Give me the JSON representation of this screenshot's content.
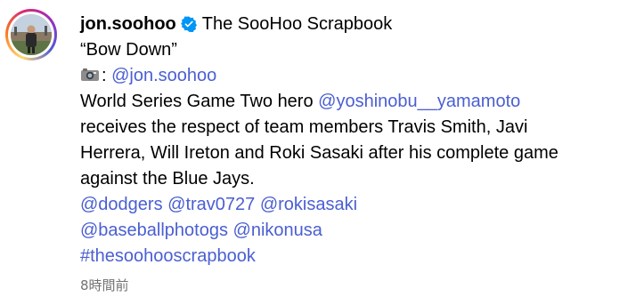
{
  "post": {
    "username": "jon.soohoo",
    "account_title": "The SooHoo Scrapbook",
    "verified": true,
    "quote_title": "“Bow Down”",
    "credit": {
      "icon": "camera-icon",
      "separator": ":",
      "handle": "@jon.soohoo"
    },
    "caption_lines": [
      {
        "text": "World Series Game Two hero ",
        "mention": "@yoshinobu__yamamoto"
      },
      {
        "text": "receives the respect of team members Travis Smith, Javi"
      },
      {
        "text": "Herrera, Will Ireton and Roki Sasaki after his complete game"
      },
      {
        "text": "against the Blue Jays."
      }
    ],
    "mentions_line_1": [
      "@dodgers",
      "@trav0727",
      "@rokisasaki"
    ],
    "mentions_line_2": [
      "@baseballphotogs",
      "@nikonusa"
    ],
    "hashtag": "#thesoohooscrapbook",
    "timestamp": "8時間前"
  },
  "colors": {
    "link": "#4a5fd1",
    "verified_badge": "#0095f6",
    "timestamp": "#737373",
    "text": "#000000"
  }
}
